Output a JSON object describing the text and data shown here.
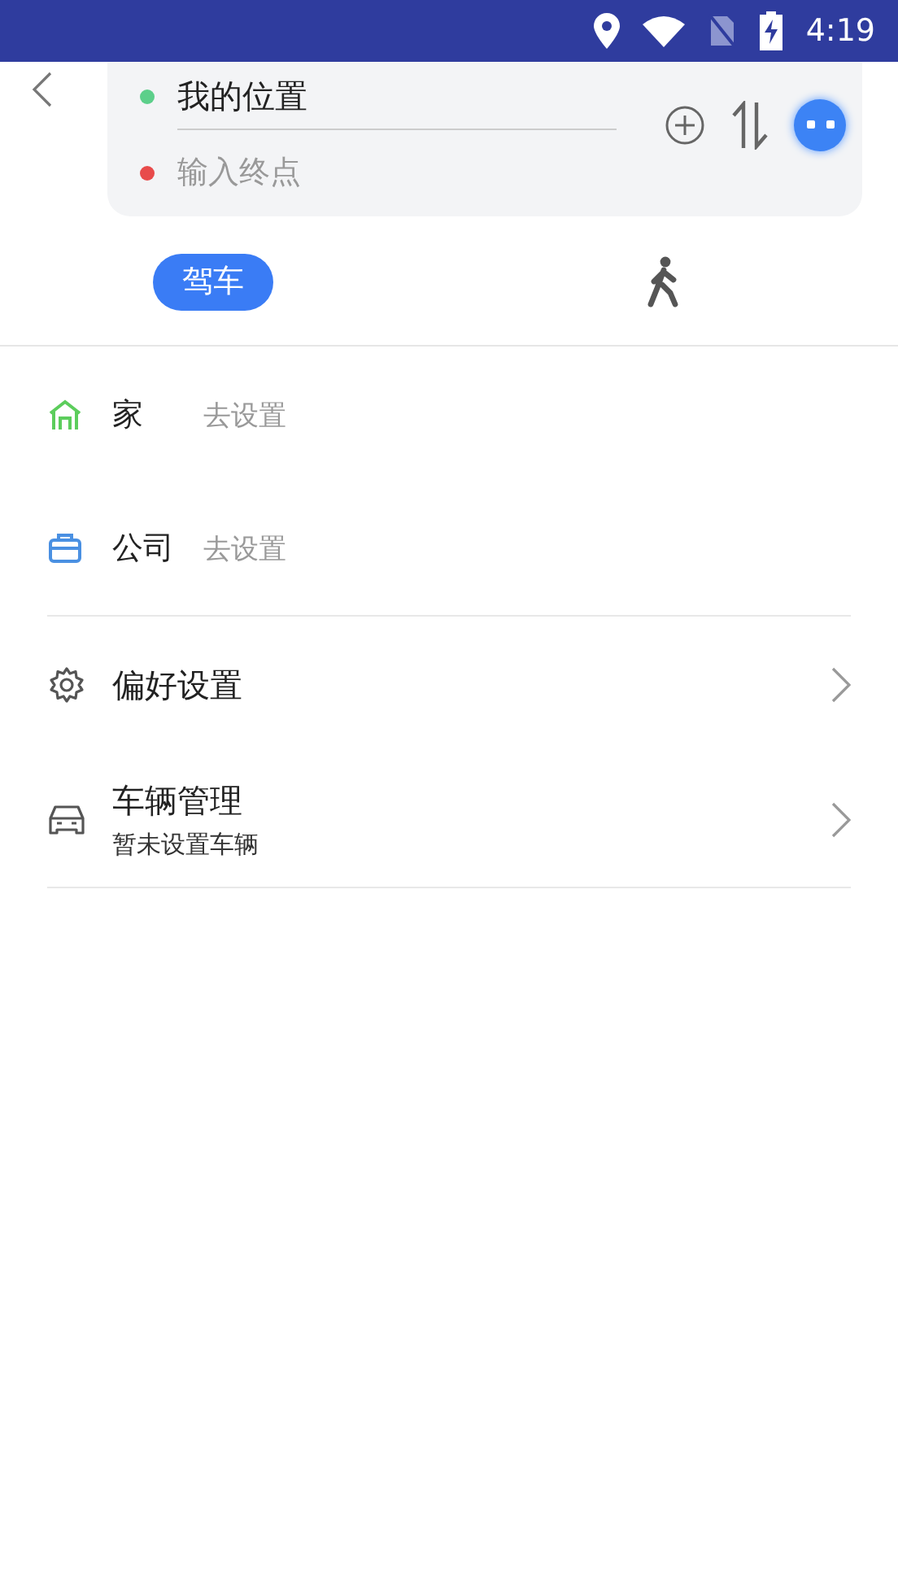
{
  "status_bar": {
    "time": "4:19"
  },
  "route": {
    "origin": "我的位置",
    "destination": {
      "placeholder": "输入终点"
    }
  },
  "modes": [
    {
      "kind": "car",
      "label": "驾车",
      "selected": true
    },
    {
      "kind": "walk",
      "selected": false
    }
  ],
  "places": [
    {
      "kind": "home",
      "name": "家",
      "action": "去设置"
    },
    {
      "kind": "work",
      "name": "公司",
      "action": "去设置"
    }
  ],
  "settings": [
    {
      "kind": "gear",
      "title": "偏好设置"
    },
    {
      "kind": "car",
      "title": "车辆管理",
      "subtitle": "暂未设置车辆"
    }
  ]
}
